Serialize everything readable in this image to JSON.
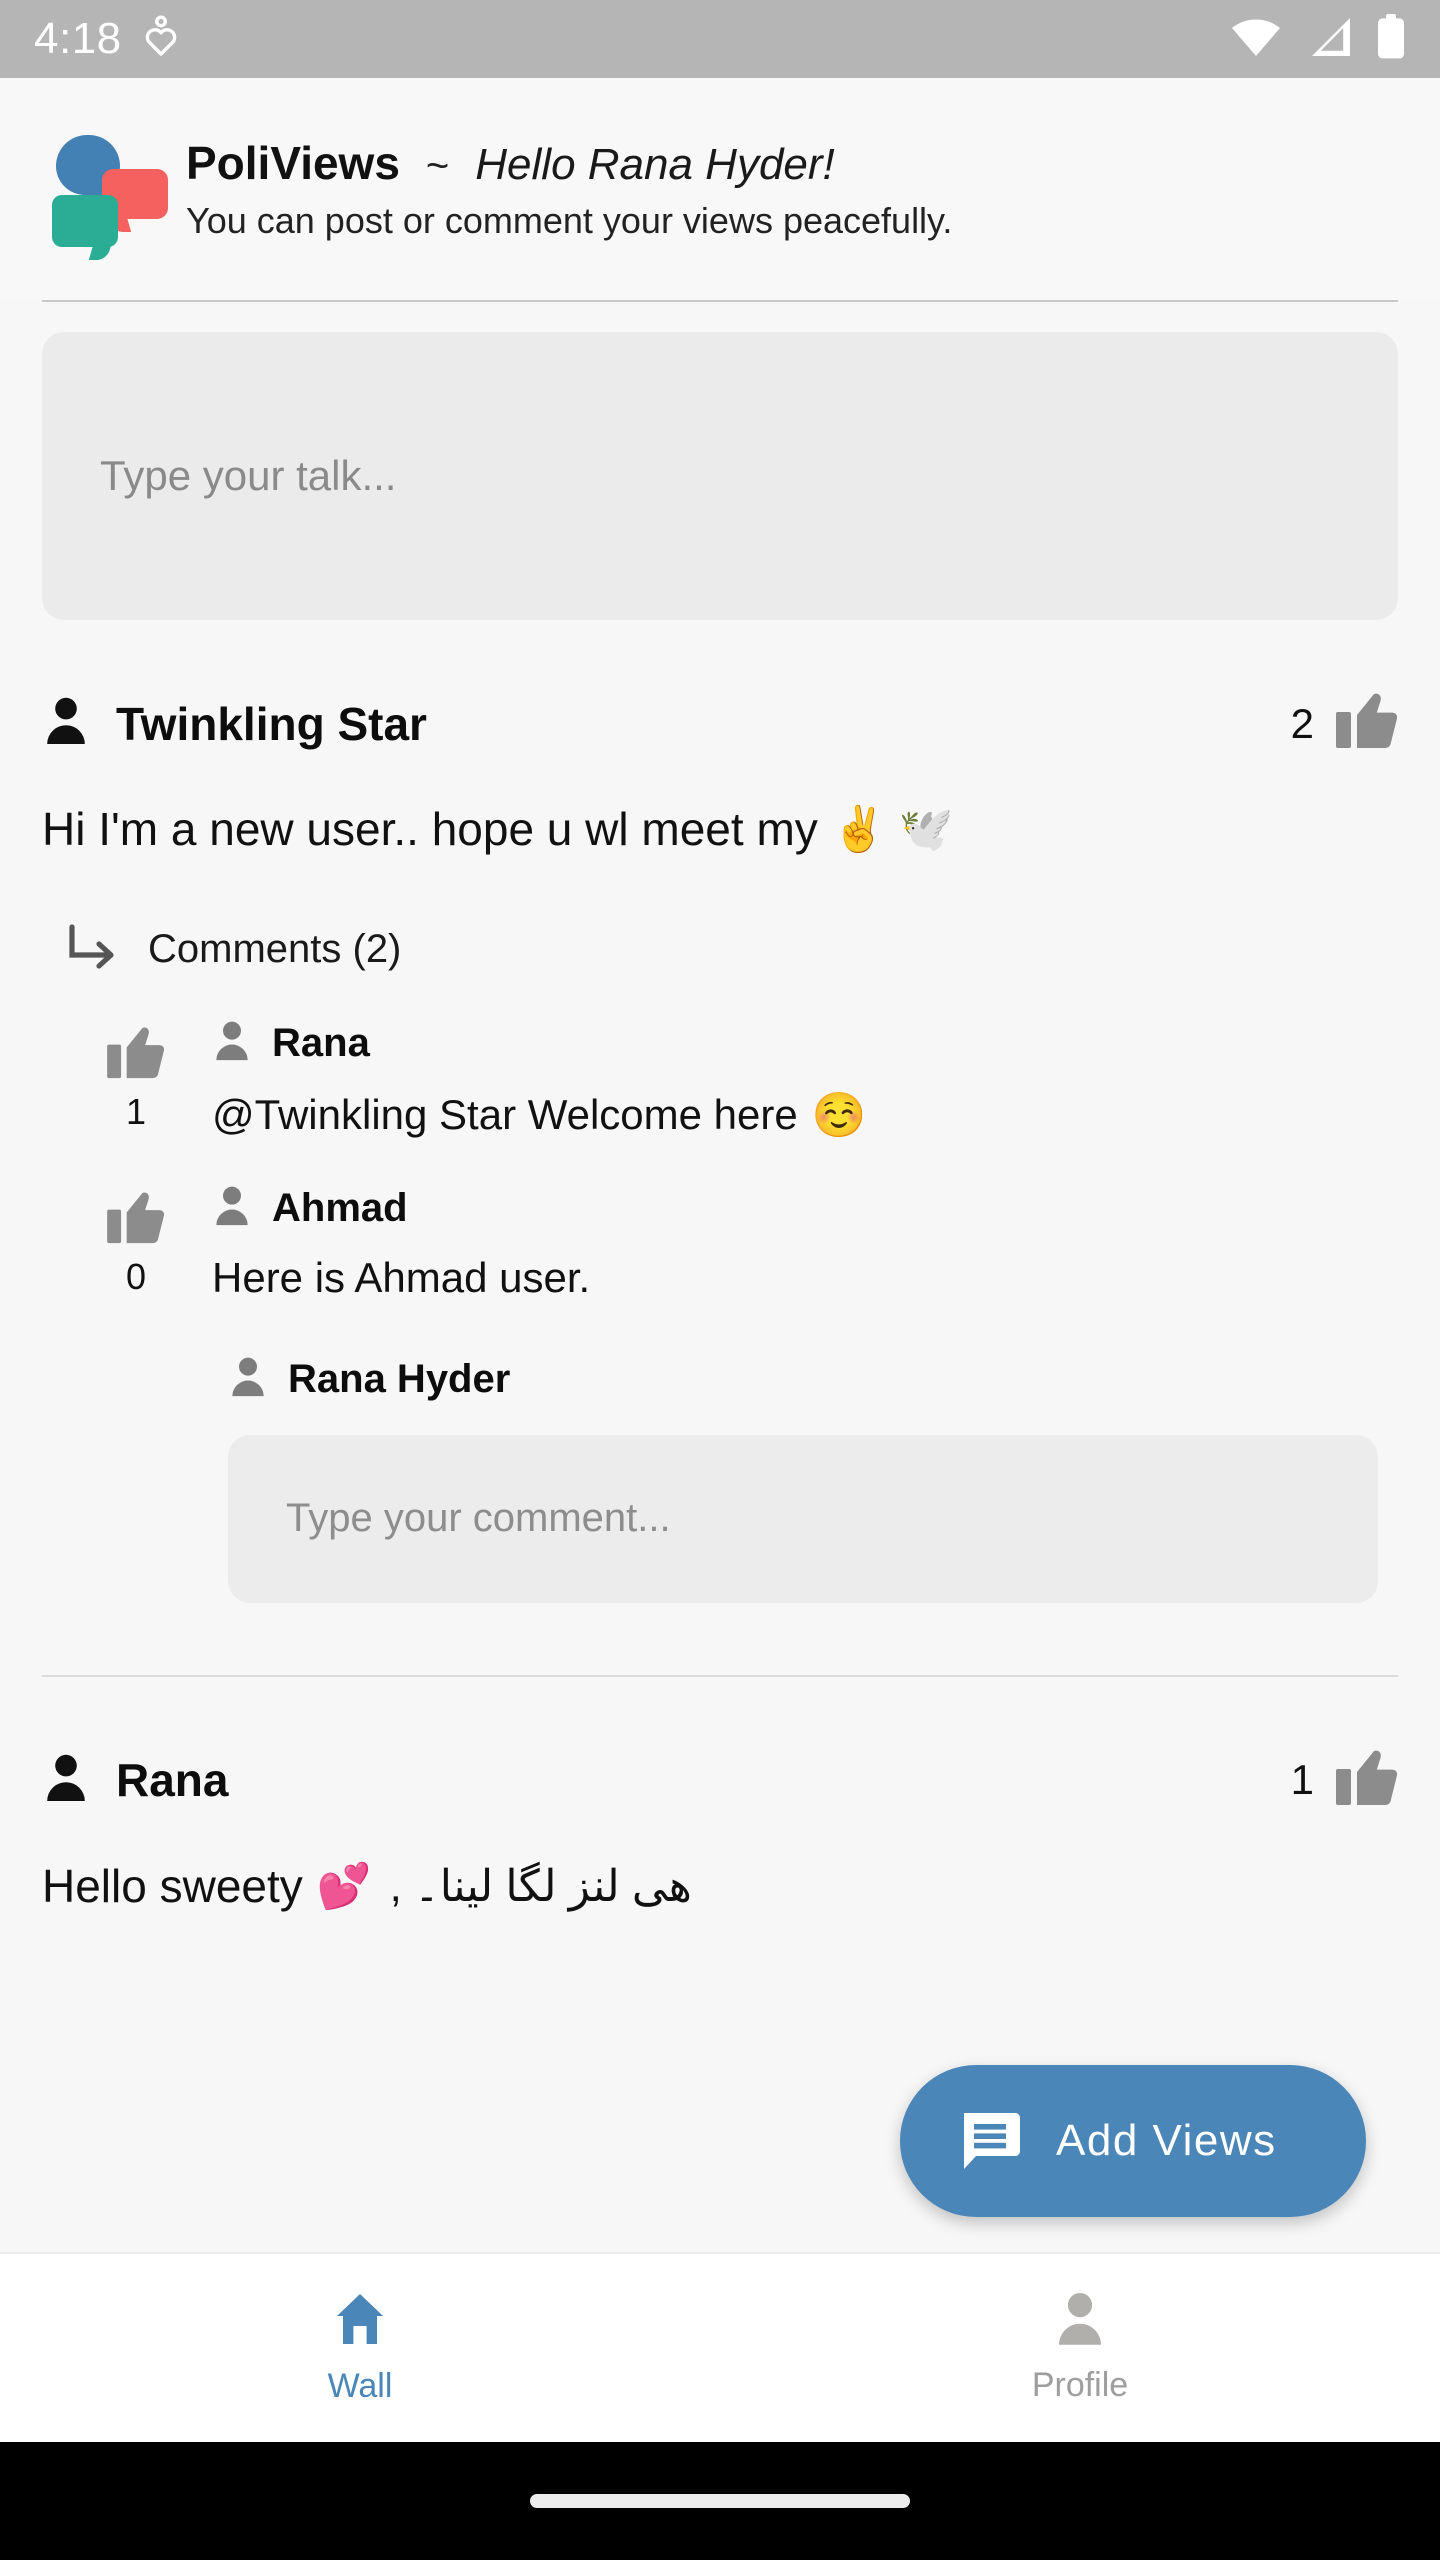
{
  "status_bar": {
    "time": "4:18",
    "icons": [
      "heart-health-icon",
      "wifi-icon",
      "cellular-signal-icon",
      "battery-icon"
    ]
  },
  "header": {
    "logo_name": "poliviews-logo",
    "app_title": "PoliViews",
    "separator": "~",
    "greeting": "Hello Rana Hyder!",
    "subtitle": "You can post or comment your views peacefully."
  },
  "composer": {
    "placeholder": "Type your talk..."
  },
  "posts": [
    {
      "author": "Twinkling Star",
      "like_count": "2",
      "text": "Hi I'm a new user.. hope u wl meet my",
      "emojis": "✌️ 🕊️",
      "comments_label": "Comments (2)",
      "comments": [
        {
          "author": "Rana",
          "like_count": "1",
          "text": "@Twinkling Star Welcome here",
          "emoji": "☺️"
        },
        {
          "author": "Ahmad",
          "like_count": "0",
          "text": "Here is Ahmad user.",
          "emoji": ""
        }
      ],
      "reply_author": "Rana Hyder",
      "comment_placeholder": "Type your comment..."
    },
    {
      "author": "Rana",
      "like_count": "1",
      "text": "Hello sweety",
      "emojis": "💕",
      "text_rtl": "ھی لنز لگا لینا۔ ,"
    }
  ],
  "fab": {
    "label": "Add Views",
    "icon": "message-lines-icon"
  },
  "bottom_nav": {
    "items": [
      {
        "label": "Wall",
        "icon": "home-icon",
        "active": true
      },
      {
        "label": "Profile",
        "icon": "person-icon",
        "active": false
      }
    ]
  },
  "colors": {
    "accent_blue": "#4a86b8",
    "logo_blue": "#4380b4",
    "logo_red": "#f4615e",
    "logo_teal": "#2bac94",
    "status_bar_gray": "#b5b5b5",
    "inactive_gray": "#9e9e9e"
  }
}
